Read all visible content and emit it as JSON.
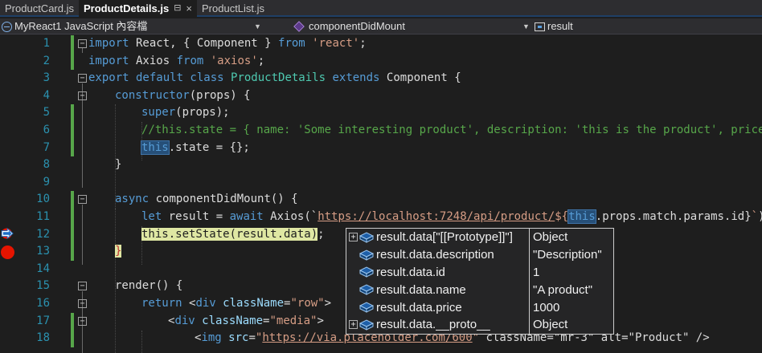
{
  "tabs": [
    {
      "label": "ProductCard.js",
      "active": false
    },
    {
      "label": "ProductDetails.js",
      "active": true
    },
    {
      "label": "ProductList.js",
      "active": false
    }
  ],
  "tab_pin_glyph": "⊟",
  "tab_close_glyph": "×",
  "navbar": {
    "project": "MyReact1 JavaScript 內容檔",
    "member": "componentDidMount",
    "field": "result"
  },
  "editor": {
    "line_numbers": [
      "1",
      "2",
      "3",
      "4",
      "5",
      "6",
      "7",
      "8",
      "9",
      "10",
      "11",
      "12",
      "13",
      "14",
      "15",
      "16",
      "17",
      "18"
    ],
    "lines": {
      "l1": {
        "kw1": "import",
        "t1": " React, { Component } ",
        "kw2": "from",
        "t2": " ",
        "str": "'react'",
        "t3": ";"
      },
      "l2": {
        "kw1": "import",
        "t1": " Axios ",
        "kw2": "from",
        "t2": " ",
        "str": "'axios'",
        "t3": ";"
      },
      "l3": {
        "kw1": "export default class",
        "t1": " ",
        "cls": "ProductDetails",
        "t2": " ",
        "kw2": "extends",
        "t3": " Component {"
      },
      "l4": {
        "kw1": "constructor",
        "t1": "(props) {"
      },
      "l5": {
        "kw1": "super",
        "t1": "(props);"
      },
      "l6": {
        "cm": "//this.state = { name: 'Some interesting product', description: 'this is the product', price:"
      },
      "l7": {
        "kw1": "this",
        "t1": ".state = {};"
      },
      "l8": {
        "t1": "}"
      },
      "l10": {
        "kw1": "async",
        "t1": " componentDidMount() {"
      },
      "l11": {
        "kw1": "let",
        "t1": " result = ",
        "kw2": "await",
        "t2": " Axios(`",
        "url": "https://localhost:7248/api/product/",
        "str": "${",
        "kw3": "this",
        "t3": ".props.match.params.id}",
        "str2": "`",
        "t4": ");"
      },
      "l12": {
        "kw1": "this",
        "t1": ".setState(result.data)",
        "t2": ";"
      },
      "l13": {
        "t1": "}"
      },
      "l15": {
        "t1": "render() {"
      },
      "l16": {
        "kw1": "return",
        "t1": " <",
        "kw2": "div",
        "t2": " ",
        "attr": "className",
        "t3": "=",
        "str": "\"row\"",
        "t4": ">"
      },
      "l17": {
        "t1": "<",
        "kw1": "div",
        "t2": " ",
        "attr": "className",
        "t3": "=",
        "str": "\"media\"",
        "t4": ">"
      },
      "l18": {
        "t1": "<",
        "kw1": "img",
        "t2": " ",
        "attr": "src",
        "t3": "=",
        "str": "\"",
        "url": "https://via.placeholder.com/600",
        "str2": "\"",
        "t4": " className=\"mr-3\" alt=\"Product\" />"
      }
    }
  },
  "datatip": {
    "rows": [
      {
        "name": "result.data[\"[[Prototype]]\"]",
        "value": "Object",
        "expandable": true
      },
      {
        "name": "result.data.description",
        "value": "\"Description\"",
        "expandable": false
      },
      {
        "name": "result.data.id",
        "value": "1",
        "expandable": false
      },
      {
        "name": "result.data.name",
        "value": "\"A product\"",
        "expandable": false
      },
      {
        "name": "result.data.price",
        "value": "1000",
        "expandable": false
      },
      {
        "name": "result.data.__proto__",
        "value": "Object",
        "expandable": true
      }
    ],
    "expand_glyph": "+"
  },
  "fold_glyph": "−",
  "colors": {
    "keyword": "#569cd6",
    "string": "#d69d85",
    "comment": "#57a64a",
    "class": "#4ec9b0",
    "function": "#dcdcaa",
    "line_number": "#2b91af",
    "breakpoint": "#e51400",
    "current_statement": "#dfe7a3"
  }
}
